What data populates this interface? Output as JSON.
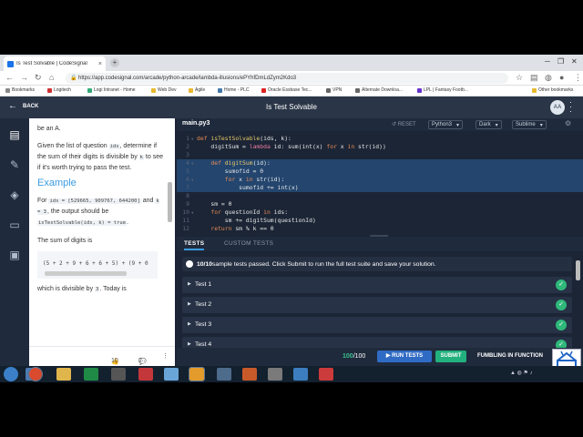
{
  "browser": {
    "tab_title": "Is Test Solvable | CodeSignal",
    "tab_close": "×",
    "new_tab": "+",
    "url": "https://app.codesignal.com/arcade/python-arcade/lambda-illusions/ePYhfDmLdZym2Kdo3",
    "bookmarks": [
      "Bookmarks",
      "Logitech",
      "Logi Intranet - Home",
      "Web Dev",
      "Agile",
      "Home - PLC",
      "Oracle Essbase Tec...",
      "VPN",
      "Alternate Downloa...",
      "LPL | Fantasy Footb..."
    ],
    "other_bookmarks": "Other bookmarks"
  },
  "app": {
    "back_label": "BACK",
    "title": "Is Test Solvable",
    "avatar": "AA"
  },
  "description": {
    "lead": "be an A.",
    "para_prefix": "Given the list of question ",
    "para_code1": "ids",
    "para_mid": ", determine if the sum of their digits is divisible by ",
    "para_code2": "k",
    "para_suffix": " to see if it's worth trying to pass the test.",
    "example_heading": "Example",
    "example_for": "For ",
    "example_ids": "ids = [529665, 909767, 644200]",
    "example_and": " and ",
    "example_k": "k = 3",
    "example_out": ", the output should be ",
    "example_call": "isTestSolvable(ids, k) = true",
    "example_end": ".",
    "sum_text": "The sum of digits is",
    "sum_code": "(5 + 2 + 9 + 6 + 6 + 5) + (9 + 0",
    "tail_prefix": "which is divisible by ",
    "tail_code": "3",
    "tail_suffix": ". Today is",
    "likes": "10",
    "comments": "2"
  },
  "editor": {
    "file_tab": "main.py3",
    "reset_label": "RESET",
    "language": "Python3",
    "theme": "Dark",
    "keymap": "Sublime",
    "lines": [
      {
        "n": "1",
        "segments": [
          {
            "t": "def ",
            "c": "kw"
          },
          {
            "t": "isTestSolvable",
            "c": "fn"
          },
          {
            "t": "(ids, k):",
            "c": ""
          }
        ]
      },
      {
        "n": "2",
        "segments": [
          {
            "t": "    digitSum = ",
            "c": ""
          },
          {
            "t": "lambda",
            "c": "lam"
          },
          {
            "t": " id: sum(int(x) ",
            "c": ""
          },
          {
            "t": "for",
            "c": "kw"
          },
          {
            "t": " x ",
            "c": ""
          },
          {
            "t": "in",
            "c": "kw"
          },
          {
            "t": " str(id))",
            "c": ""
          }
        ]
      },
      {
        "n": "3",
        "segments": [
          {
            "t": "",
            "c": ""
          }
        ]
      },
      {
        "n": "4",
        "segments": [
          {
            "t": "    ",
            "c": ""
          },
          {
            "t": "def ",
            "c": "kw"
          },
          {
            "t": "digitSum",
            "c": "fn"
          },
          {
            "t": "(id):",
            "c": ""
          }
        ]
      },
      {
        "n": "5",
        "segments": [
          {
            "t": "        sumofid = 0",
            "c": ""
          }
        ]
      },
      {
        "n": "6",
        "segments": [
          {
            "t": "        ",
            "c": ""
          },
          {
            "t": "for",
            "c": "kw"
          },
          {
            "t": " x ",
            "c": ""
          },
          {
            "t": "in",
            "c": "kw"
          },
          {
            "t": " str(id):",
            "c": ""
          }
        ]
      },
      {
        "n": "7",
        "segments": [
          {
            "t": "            sumofid += int(x)",
            "c": ""
          }
        ]
      },
      {
        "n": "8",
        "segments": [
          {
            "t": "",
            "c": ""
          }
        ]
      },
      {
        "n": "9",
        "segments": [
          {
            "t": "    sm = 0",
            "c": ""
          }
        ]
      },
      {
        "n": "10",
        "segments": [
          {
            "t": "    ",
            "c": ""
          },
          {
            "t": "for",
            "c": "kw"
          },
          {
            "t": " questionId ",
            "c": ""
          },
          {
            "t": "in",
            "c": "kw"
          },
          {
            "t": " ids:",
            "c": ""
          }
        ]
      },
      {
        "n": "11",
        "segments": [
          {
            "t": "        sm += digitSum(questionId)",
            "c": ""
          }
        ]
      },
      {
        "n": "12",
        "segments": [
          {
            "t": "    ",
            "c": ""
          },
          {
            "t": "return",
            "c": "kw"
          },
          {
            "t": " sm % k == 0",
            "c": ""
          }
        ]
      }
    ]
  },
  "tests": {
    "tab_tests": "TESTS",
    "tab_custom": "CUSTOM TESTS",
    "summary_bold": "10/10",
    "summary_text": " sample tests passed. Click Submit to run the full test suite and save your solution.",
    "items": [
      "Test 1",
      "Test 2",
      "Test 3",
      "Test 4"
    ],
    "score_num": "100",
    "score_den": "/100",
    "run_label": "RUN TESTS",
    "submit_label": "SUBMIT"
  },
  "watermark": "FUMBLING IN FUNCTION"
}
